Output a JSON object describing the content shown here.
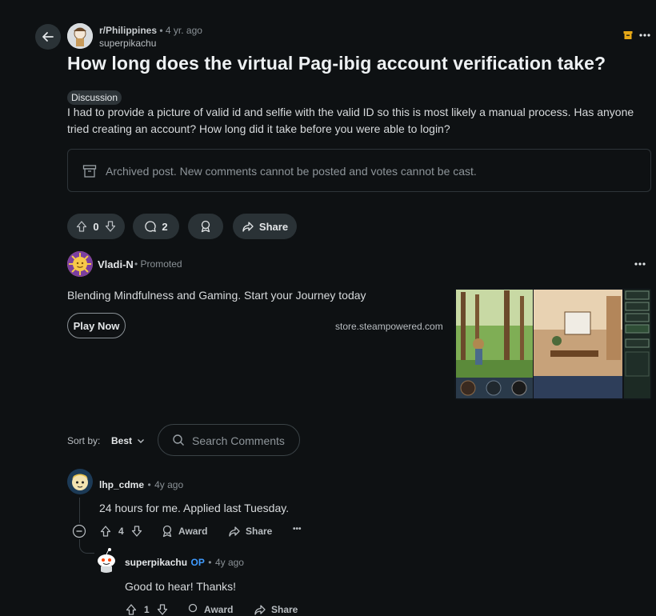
{
  "post": {
    "subreddit": "r/Philippines",
    "sep": "•",
    "age": "4 yr. ago",
    "author": "superpikachu",
    "title": "How long does the virtual Pag-ibig account verification take?",
    "flair": "Discussion",
    "body": "I had to provide a picture of valid id and selfie with the valid ID so this is most likely a manual process. Has anyone tried creating an account? How long did it take before you were able to login?",
    "archived_notice": "Archived post. New comments cannot be posted and votes cannot be cast.",
    "votes": "0",
    "comments_count": "2",
    "share_label": "Share"
  },
  "ad": {
    "advertiser": "Vladi-N",
    "sep": "•",
    "promoted_label": "Promoted",
    "headline": "Blending Mindfulness and Gaming. Start your Journey today",
    "cta_label": "Play Now",
    "domain": "store.steampowered.com"
  },
  "sort": {
    "label": "Sort by:",
    "value": "Best",
    "search_placeholder": "Search Comments"
  },
  "comments": [
    {
      "author": "lhp_cdme",
      "sep": "•",
      "age": "4y ago",
      "body": "24 hours for me. Applied last Tuesday.",
      "votes": "4",
      "award_label": "Award",
      "share_label": "Share",
      "more": "•••"
    },
    {
      "author": "superpikachu",
      "op_badge": "OP",
      "sep": "•",
      "age": "4y ago",
      "body": "Good to hear! Thanks!",
      "votes": "1",
      "award_label": "Award",
      "share_label": "Share"
    }
  ],
  "colors": {
    "background": "#0e1113",
    "pill": "#2a3236",
    "op": "#3f9bff",
    "archive_icon": "#e6a817"
  }
}
